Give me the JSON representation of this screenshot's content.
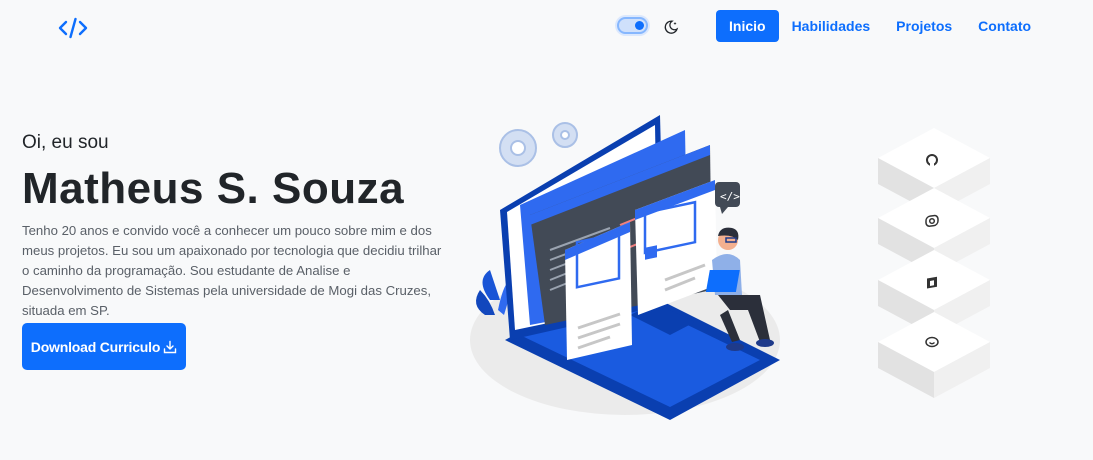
{
  "nav": {
    "logo_icon": "code-icon",
    "theme_toggle_icon": "toggle-icon",
    "theme_icon": "moon-icon",
    "items": [
      {
        "label": "Inicio",
        "active": true
      },
      {
        "label": "Habilidades",
        "active": false
      },
      {
        "label": "Projetos",
        "active": false
      },
      {
        "label": "Contato",
        "active": false
      }
    ]
  },
  "hero": {
    "greeting": "Oi, eu sou",
    "name": "Matheus S. Souza",
    "bio": "Tenho 20 anos e convido você a conhecer um pouco sobre mim e dos meus projetos. Eu sou um apaixonado por tecnologia que decidiu trilhar o caminho da programação. Sou estudante de Analise e Desenvolvimento de Sistemas pela universidade de Mogi das Cruzes, situada em SP.",
    "download_label": "Download Curriculo",
    "download_icon": "download-icon"
  },
  "social": [
    {
      "icon": "github-icon"
    },
    {
      "icon": "instagram-icon"
    },
    {
      "icon": "linkedin-icon"
    },
    {
      "icon": "whatsapp-icon"
    }
  ],
  "colors": {
    "primary": "#0d6efd",
    "background": "#f8f9fa",
    "text": "#212529",
    "muted": "#5a6068"
  }
}
